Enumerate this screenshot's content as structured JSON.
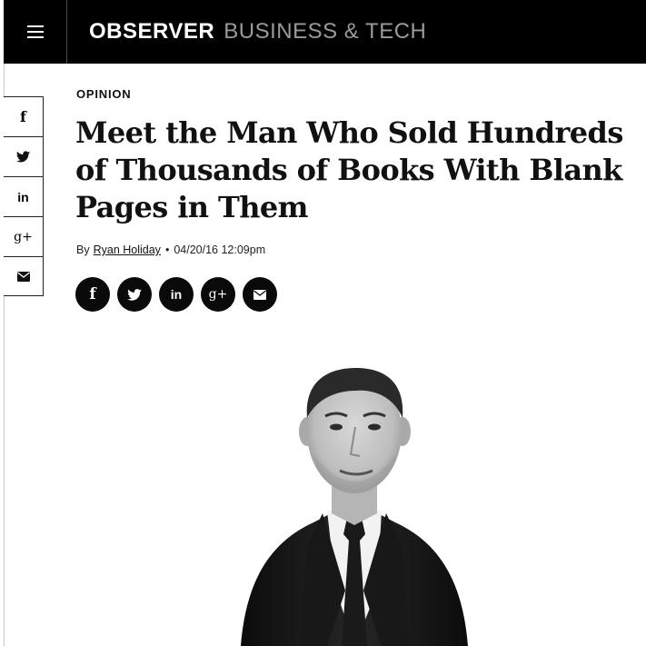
{
  "header": {
    "brand_main": "OBSERVER",
    "brand_section": "BUSINESS & TECH",
    "menu_icon": "hamburger-menu-icon"
  },
  "share_sidebar": {
    "items": [
      {
        "icon": "facebook-icon",
        "glyph": "f"
      },
      {
        "icon": "twitter-icon",
        "glyph": ""
      },
      {
        "icon": "linkedin-icon",
        "glyph": "in"
      },
      {
        "icon": "google-plus-icon",
        "glyph": "g+"
      },
      {
        "icon": "email-icon",
        "glyph": ""
      }
    ]
  },
  "article": {
    "kicker": "OPINION",
    "headline": "Meet the Man Who Sold Hundreds of Thousands of Books With Blank Pages in Them",
    "byline": {
      "prefix": "By",
      "author": "Ryan Holiday",
      "separator": "•",
      "datetime": "04/20/16 12:09pm"
    },
    "share_buttons": [
      {
        "icon": "facebook-icon",
        "glyph": "f"
      },
      {
        "icon": "twitter-icon",
        "glyph": ""
      },
      {
        "icon": "linkedin-icon",
        "glyph": "in"
      },
      {
        "icon": "google-plus-icon",
        "glyph": "g+"
      },
      {
        "icon": "email-icon",
        "glyph": ""
      }
    ],
    "hero_image": "author-portrait-photo"
  },
  "colors": {
    "header_bg": "#000000",
    "brand_main": "#ffffff",
    "brand_section": "#9a9a9a",
    "button_bg": "#0a0a0a"
  }
}
